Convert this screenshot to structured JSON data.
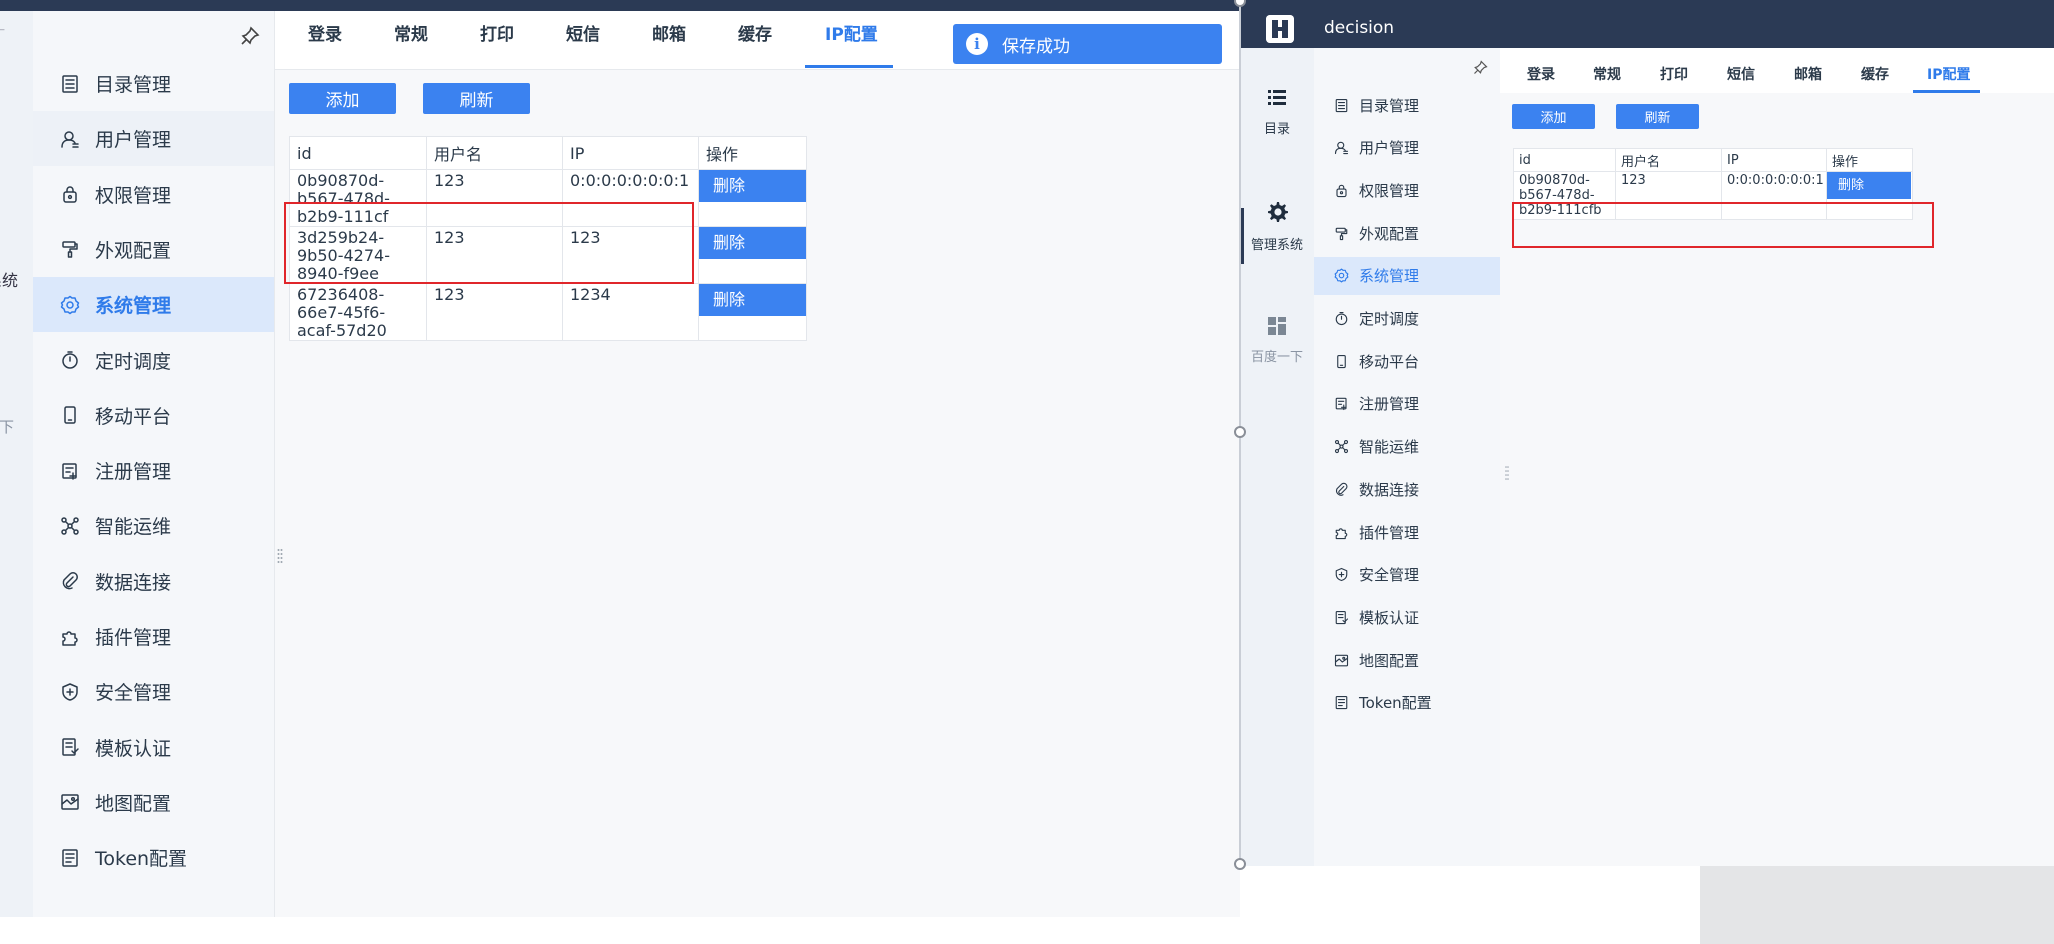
{
  "left_panel": {
    "nav_fragments": [
      "系统",
      "一下"
    ],
    "menu": [
      {
        "label": "目录管理",
        "icon": "catalog-icon"
      },
      {
        "label": "用户管理",
        "icon": "user-icon"
      },
      {
        "label": "权限管理",
        "icon": "lock-icon"
      },
      {
        "label": "外观配置",
        "icon": "paint-roller-icon"
      },
      {
        "label": "系统管理",
        "icon": "gear-icon",
        "active": true
      },
      {
        "label": "定时调度",
        "icon": "timer-icon"
      },
      {
        "label": "移动平台",
        "icon": "mobile-icon"
      },
      {
        "label": "注册管理",
        "icon": "register-icon"
      },
      {
        "label": "智能运维",
        "icon": "network-icon"
      },
      {
        "label": "数据连接",
        "icon": "paperclip-icon"
      },
      {
        "label": "插件管理",
        "icon": "puzzle-icon"
      },
      {
        "label": "安全管理",
        "icon": "shield-icon"
      },
      {
        "label": "模板认证",
        "icon": "template-icon"
      },
      {
        "label": "地图配置",
        "icon": "map-icon"
      },
      {
        "label": "Token配置",
        "icon": "token-icon"
      }
    ],
    "tabs": [
      "登录",
      "常规",
      "打印",
      "短信",
      "邮箱",
      "缓存",
      "IP配置"
    ],
    "active_tab": "IP配置",
    "toast": {
      "icon": "info-icon",
      "text": "保存成功"
    },
    "buttons": {
      "add": "添加",
      "refresh": "刷新"
    },
    "table": {
      "headers": [
        "id",
        "用户名",
        "IP",
        "操作"
      ],
      "rows": [
        {
          "id": "0b90870d-b567-478d-b2b9-111cf",
          "user": "123",
          "ip": "0:0:0:0:0:0:0:1",
          "action": "删除"
        },
        {
          "id": "3d259b24-9b50-4274-8940-f9ee",
          "user": "123",
          "ip": "123",
          "action": "删除"
        },
        {
          "id": "67236408-66e7-45f6-acaf-57d20",
          "user": "123",
          "ip": "1234",
          "action": "删除"
        }
      ]
    }
  },
  "right_panel": {
    "app_title": "decision",
    "leftbar": [
      {
        "label": "目录",
        "icon": "list-icon"
      },
      {
        "label": "管理系统",
        "icon": "gear-icon",
        "active": true
      },
      {
        "label": "百度一下",
        "icon": "grid-icon"
      }
    ],
    "menu": [
      {
        "label": "目录管理"
      },
      {
        "label": "用户管理"
      },
      {
        "label": "权限管理"
      },
      {
        "label": "外观配置"
      },
      {
        "label": "系统管理",
        "active": true
      },
      {
        "label": "定时调度"
      },
      {
        "label": "移动平台"
      },
      {
        "label": "注册管理"
      },
      {
        "label": "智能运维"
      },
      {
        "label": "数据连接"
      },
      {
        "label": "插件管理"
      },
      {
        "label": "安全管理"
      },
      {
        "label": "模板认证"
      },
      {
        "label": "地图配置"
      },
      {
        "label": "Token配置"
      }
    ],
    "tabs": [
      "登录",
      "常规",
      "打印",
      "短信",
      "邮箱",
      "缓存",
      "IP配置"
    ],
    "active_tab": "IP配置",
    "buttons": {
      "add": "添加",
      "refresh": "刷新"
    },
    "table": {
      "headers": [
        "id",
        "用户名",
        "IP",
        "操作"
      ],
      "rows": [
        {
          "id": "0b90870d-b567-478d-b2b9-111cfb",
          "user": "123",
          "ip": "0:0:0:0:0:0:0:1",
          "action": "删除"
        }
      ]
    }
  },
  "colors": {
    "accent": "#3b82f0",
    "header": "#2b3a55",
    "highlight": "#e0262b",
    "active_bg": "#dbe8fb"
  }
}
